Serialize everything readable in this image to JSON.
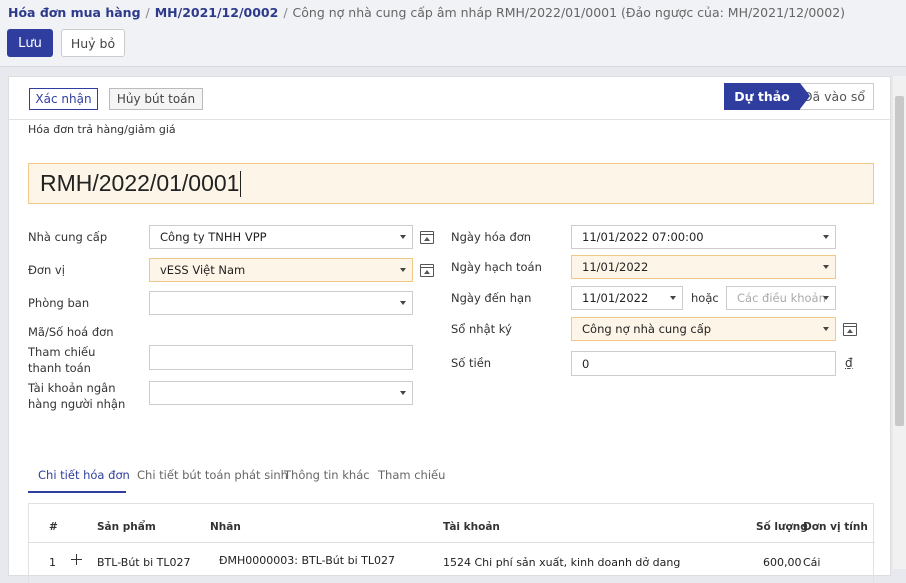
{
  "breadcrumb": {
    "root": "Hóa đơn mua hàng",
    "parent": "MH/2021/12/0002",
    "current": "Công nợ nhà cung cấp âm nháp RMH/2022/01/0001 (Đảo ngược của: MH/2021/12/0002)",
    "separator": "/"
  },
  "toolbar": {
    "save_label": "Lưu",
    "discard_label": "Huỷ bỏ"
  },
  "actions": {
    "confirm_label": "Xác nhận",
    "cancel_entry_label": "Hủy bút toán"
  },
  "status": {
    "draft": "Dự thảo",
    "posted": "Đã vào sổ"
  },
  "document": {
    "type": "Hóa đơn trả hàng/giảm giá",
    "name": "RMH/2022/01/0001"
  },
  "left_fields": {
    "vendor_label": "Nhà cung cấp",
    "vendor_value": "Công ty TNHH VPP",
    "company_label": "Đơn vị",
    "company_value": "vESS Việt Nam",
    "department_label": "Phòng ban",
    "department_value": "",
    "invoice_no_label": "Mã/Số hoá đơn",
    "payment_ref_label": "Tham chiếu thanh toán",
    "payment_ref_value": "",
    "bank_account_label": "Tài khoản ngân hàng người nhận",
    "bank_account_value": ""
  },
  "right_fields": {
    "invoice_date_label": "Ngày hóa đơn",
    "invoice_date_value": "11/01/2022 07:00:00",
    "accounting_date_label": "Ngày hạch toán",
    "accounting_date_value": "11/01/2022",
    "due_date_label": "Ngày đến hạn",
    "due_date_value": "11/01/2022",
    "or_label": "hoặc",
    "terms_placeholder": "Các điều khoản",
    "journal_label": "Sổ nhật ký",
    "journal_value": "Công nợ nhà cung cấp",
    "amount_label": "Số tiền",
    "amount_value": "0",
    "currency_symbol": "₫"
  },
  "tabs": [
    {
      "label": "Chi tiết hóa đơn"
    },
    {
      "label": "Chi tiết bút toán phát sinh"
    },
    {
      "label": "Thông tin khác"
    },
    {
      "label": "Tham chiếu"
    }
  ],
  "table": {
    "headers": {
      "index": "#",
      "product": "Sản phẩm",
      "label": "Nhãn",
      "account": "Tài khoản",
      "quantity": "Số lượng",
      "uom": "Đơn vị tính"
    },
    "rows": [
      {
        "index": "1",
        "product": "BTL-Bút bi TL027",
        "label": "ĐMH0000003: BTL-Bút bi TL027",
        "account": "1524 Chi phí sản xuất, kinh doanh dở dang",
        "quantity": "600,00",
        "uom": "Cái"
      }
    ]
  },
  "colors": {
    "primary": "#2f3e9e",
    "required_bg": "#fdf6e8",
    "required_border": "#f0c98a"
  }
}
